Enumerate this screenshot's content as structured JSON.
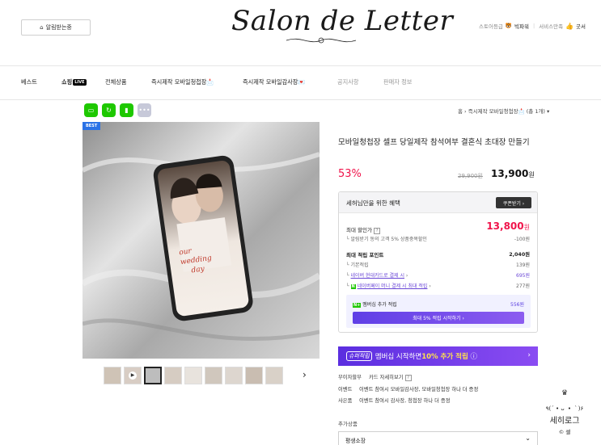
{
  "header": {
    "alarm_label": "알림받는중",
    "logo_text": "Salon de Letter",
    "util": {
      "store_grade": "스토어등급",
      "grade_value": "빅파워",
      "service": "서비스만족",
      "cut": "굿서"
    }
  },
  "nav": {
    "items": [
      {
        "label": "베스트"
      },
      {
        "label": "쇼핑"
      },
      {
        "label": "전체상품"
      },
      {
        "label": "즉시제작 모바일청첩장📩"
      },
      {
        "label": "즉시제작 모바일감사장💌"
      },
      {
        "label": "공지사항"
      },
      {
        "label": "판매자 정보"
      }
    ],
    "live_badge": "LIVE"
  },
  "breadcrumb": "홈 › 즉시제작 모바일청첩장📩 (총 1개) ▾",
  "product": {
    "best_badge": "BEST",
    "title": "모바일청첩장 셀프 당일제작 참석여부 결혼식 초대장 만들기",
    "discount": "53%",
    "original_price": "29,900원",
    "price": "13,900",
    "price_unit": "원"
  },
  "benefit": {
    "title": "세허님만을 위한 혜택",
    "coupon_button": "쿠폰받기 ›",
    "max_discount_label": "최대 할인가",
    "max_discount_value": "13,800",
    "max_discount_unit": "원",
    "alarm_discount": "└ 알림받기 동의 고객 5% 상품중복할인",
    "alarm_discount_value": "-100원",
    "max_point_label": "최대 적립 포인트",
    "max_point_value": "2,040원",
    "base_point": "└ 기본적립",
    "base_point_value": "139원",
    "card_point": "네이버 현대카드로 결제 시",
    "card_point_value": "695원",
    "money_point": "네이버페이 머니 결제 시 최대 적립",
    "money_point_value": "277원",
    "membership_label": "멤버십 추가 적립",
    "membership_value": "556원",
    "membership_button": "최대 5% 적립 시작하기 ›",
    "npay_tag": "N+"
  },
  "super_bar": {
    "tag": "슈퍼적립",
    "text_a": "멤버십 시작하면 ",
    "text_b": "10% 추가 적립",
    "info": "ⓘ"
  },
  "info_rows": [
    {
      "key": "무이자할부",
      "value": "카드 자세히보기"
    },
    {
      "key": "이벤트",
      "value": "이벤트 참여시 모바일감사장, 모바일청첩장 하나 더 증정"
    },
    {
      "key": "사은품",
      "value": "이벤트 참여시 감사장, 청첩장 하나 더 증정"
    }
  ],
  "addon": {
    "label": "추가상품",
    "select_value": "평생소장"
  },
  "watermark": {
    "dots": "٩(ˊ • ᴗ • ˋ)۶",
    "name": "세히로그",
    "copy": "© 셀"
  },
  "colors": {
    "accent_red": "#f0144b",
    "naver_green": "#1ec800",
    "membership_purple": "#5f3fe6",
    "best_blue": "#2a72e6"
  }
}
